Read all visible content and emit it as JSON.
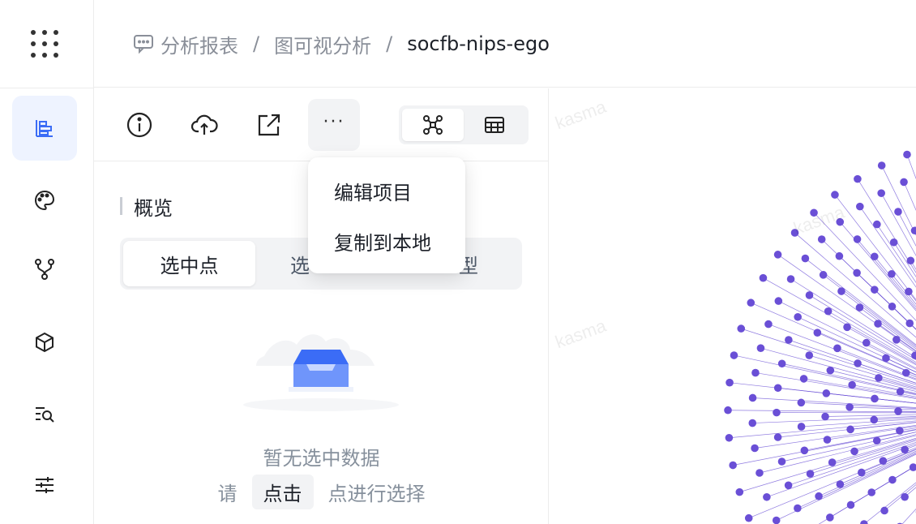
{
  "breadcrumb": {
    "items": [
      "分析报表",
      "图可视分析",
      "socfb-nips-ego"
    ],
    "separator": "/"
  },
  "sidebar": {
    "items": [
      {
        "name": "layers",
        "icon": "layers-icon",
        "active": true
      },
      {
        "name": "palette",
        "icon": "palette-icon",
        "active": false
      },
      {
        "name": "branch",
        "icon": "branch-icon",
        "active": false
      },
      {
        "name": "cube",
        "icon": "cube-icon",
        "active": false
      },
      {
        "name": "search-list",
        "icon": "search-list-icon",
        "active": false
      },
      {
        "name": "sliders",
        "icon": "sliders-icon",
        "active": false
      }
    ]
  },
  "toolbar": {
    "more_label": "···",
    "view_mode": "graph"
  },
  "dropdown": {
    "items": [
      "编辑项目",
      "复制到本地"
    ]
  },
  "overview": {
    "title": "概览",
    "tabs": [
      "选中点",
      "选",
      "型"
    ]
  },
  "empty": {
    "title": "暂无选中数据",
    "hint_prefix": "请",
    "hint_key": "点击",
    "hint_suffix": "点进行选择"
  },
  "canvas": {
    "watermark": "kasma",
    "node_color": "#6a4fd6",
    "edge_color": "#6a4fd6"
  },
  "colors": {
    "accent": "#3b6cf6",
    "active_bg": "#eef3ff"
  }
}
